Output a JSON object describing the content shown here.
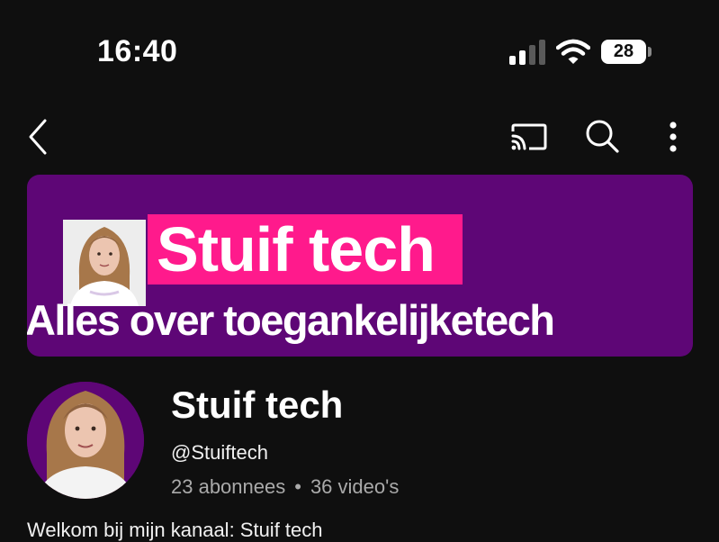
{
  "status_bar": {
    "time": "16:40",
    "battery_level": "28",
    "signal_bars_active": 2,
    "signal_bars_total": 4
  },
  "nav": {
    "icons": [
      "back-icon",
      "cast-icon",
      "search-icon",
      "more-vert-icon"
    ]
  },
  "banner": {
    "title": "Stuif tech",
    "subtitle": "Alles over toegankelijketech",
    "background_color": "#5e0676",
    "title_highlight_color": "#ff1a8c"
  },
  "channel": {
    "name": "Stuif tech",
    "handle": "@Stuiftech",
    "subscribers": "23 abonnees",
    "separator": "•",
    "videos": "36 video's",
    "description_partial": "Welkom bij mijn kanaal: Stuif tech"
  },
  "colors": {
    "background": "#0f0f0f",
    "text_primary": "#ffffff",
    "text_secondary": "#aaaaaa"
  }
}
